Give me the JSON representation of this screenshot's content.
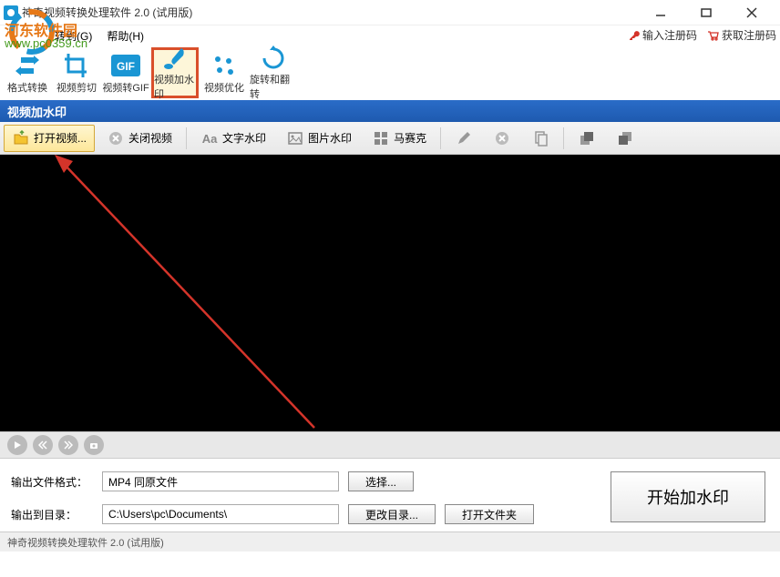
{
  "titlebar": {
    "title": "神奇视频转换处理软件 2.0 (试用版)"
  },
  "watermark": {
    "text": "河东软件园",
    "url": "www.pc0359.cn"
  },
  "menubar": {
    "goto": "转到(G)",
    "help": "帮助(H)"
  },
  "reg": {
    "enter_code": "输入注册码",
    "get_code": "获取注册码"
  },
  "main_tools": [
    {
      "name": "format-convert",
      "label": "格式转换"
    },
    {
      "name": "video-crop",
      "label": "视频剪切"
    },
    {
      "name": "video-to-gif",
      "label": "视频转GIF"
    },
    {
      "name": "video-watermark",
      "label": "视频加水印"
    },
    {
      "name": "video-optimize",
      "label": "视频优化"
    },
    {
      "name": "rotate-flip",
      "label": "旋转和翻转"
    }
  ],
  "section_title": "视频加水印",
  "sub_tools": {
    "open_video": "打开视频...",
    "close_video": "关闭视频",
    "text_wm": "文字水印",
    "image_wm": "图片水印",
    "mosaic": "马赛克"
  },
  "output": {
    "format_label": "输出文件格式：",
    "format_value": "MP4 同原文件",
    "select_btn": "选择...",
    "dir_label": "输出到目录：",
    "dir_value": "C:\\Users\\pc\\Documents\\",
    "change_dir_btn": "更改目录...",
    "open_folder_btn": "打开文件夹",
    "start_btn": "开始加水印"
  },
  "statusbar": "神奇视频转换处理软件 2.0 (试用版)"
}
